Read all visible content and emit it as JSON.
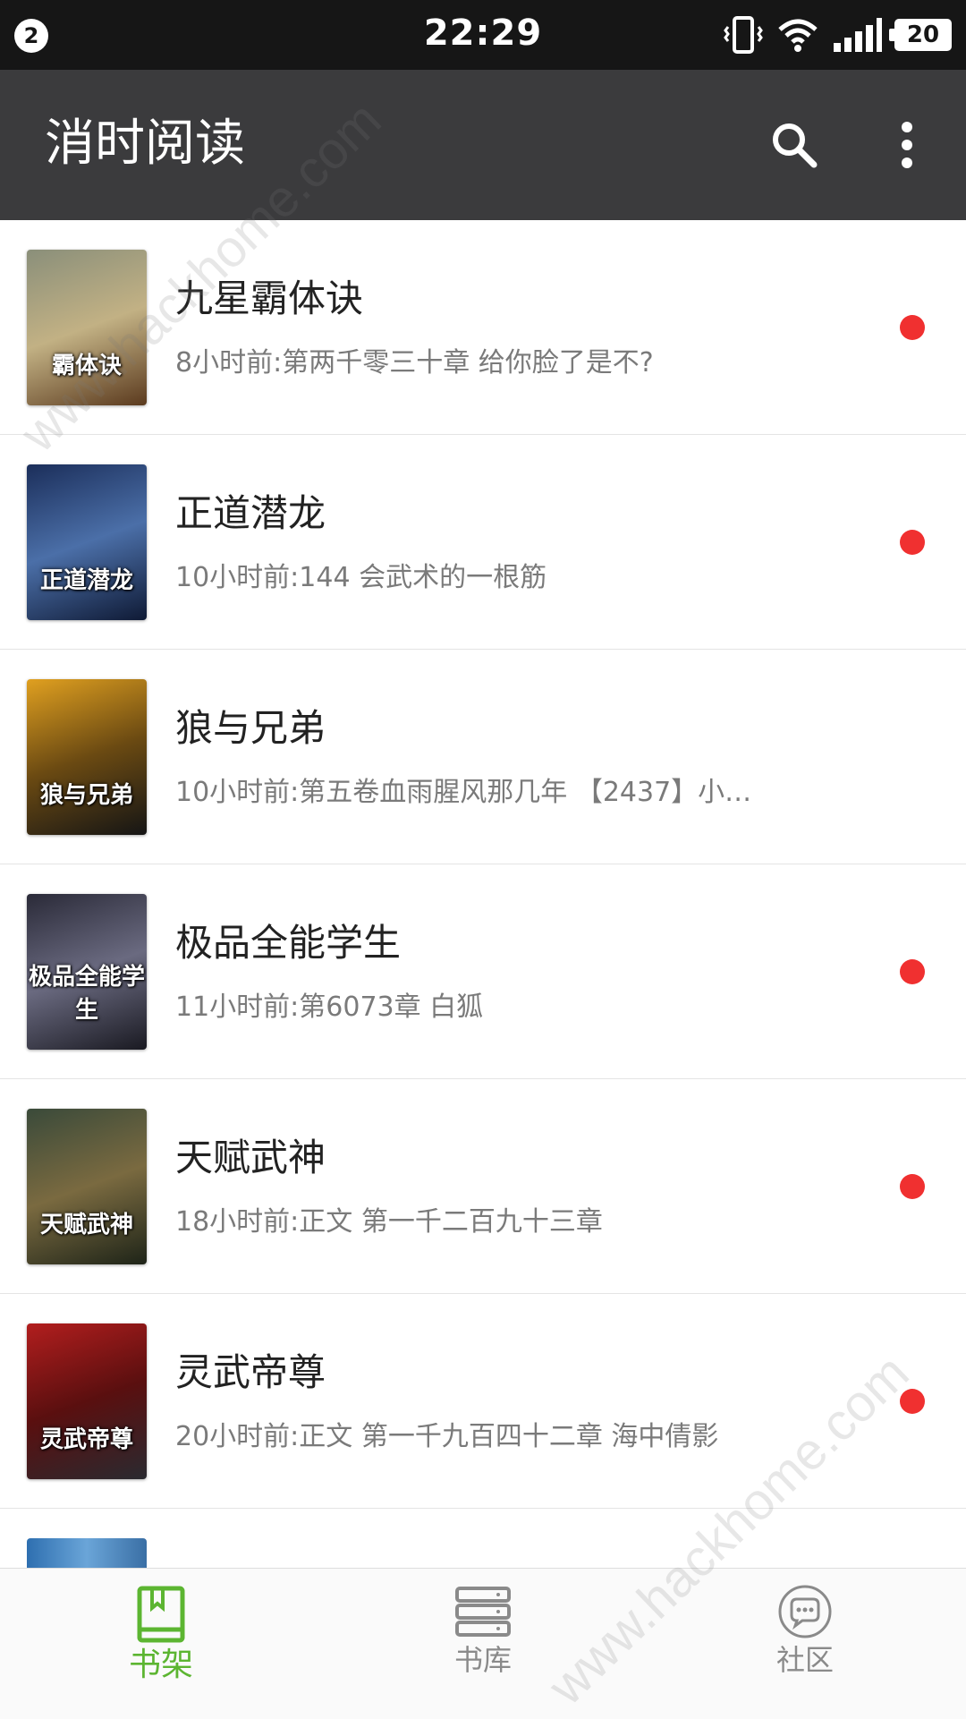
{
  "status_bar": {
    "notification_count": "2",
    "time": "22:29",
    "battery": "20",
    "icons": [
      "vibrate-icon",
      "wifi-icon",
      "signal-icon",
      "battery-icon"
    ]
  },
  "app_bar": {
    "title": "消时阅读",
    "actions": [
      "search-icon",
      "more-vert-icon"
    ]
  },
  "books": [
    {
      "title": "九星霸体诀",
      "update": "8小时前:第两千零三十章 给你脸了是不?",
      "unread": true,
      "cover_text": "霸体诀",
      "cover_colors": [
        "#8a8f7a",
        "#c2b184",
        "#5b3a1e"
      ]
    },
    {
      "title": "正道潜龙",
      "update": "10小时前:144 会武术的一根筋",
      "unread": true,
      "cover_text": "正道潜龙",
      "cover_colors": [
        "#1b2e5a",
        "#4b6fa8",
        "#0f1a35"
      ]
    },
    {
      "title": "狼与兄弟",
      "update": "10小时前:第五卷血雨腥风那几年 【2437】小…",
      "unread": false,
      "cover_text": "狼与兄弟",
      "cover_colors": [
        "#e0a020",
        "#6b4a12",
        "#151515"
      ]
    },
    {
      "title": "极品全能学生",
      "update": "11小时前:第6073章 白狐",
      "unread": true,
      "cover_text": "极品全能学生",
      "cover_colors": [
        "#2a2a38",
        "#6a6a80",
        "#1a1a22"
      ]
    },
    {
      "title": "天赋武神",
      "update": "18小时前:正文 第一千二百九十三章",
      "unread": true,
      "cover_text": "天赋武神",
      "cover_colors": [
        "#3a4a3a",
        "#7a6a40",
        "#1e2418"
      ]
    },
    {
      "title": "灵武帝尊",
      "update": "20小时前:正文 第一千九百四十二章 海中倩影",
      "unread": true,
      "cover_text": "灵武帝尊",
      "cover_colors": [
        "#b21e1e",
        "#5a0f0f",
        "#2a2a30"
      ]
    }
  ],
  "bottom_nav": [
    {
      "label": "书架",
      "icon": "bookshelf-icon",
      "active": true
    },
    {
      "label": "书库",
      "icon": "library-icon",
      "active": false
    },
    {
      "label": "社区",
      "icon": "community-icon",
      "active": false
    }
  ],
  "colors": {
    "status_bar": "#161616",
    "app_bar": "#3b3b3d",
    "accent": "#5cb531",
    "unread_dot": "#f03030"
  },
  "watermark": "www.hackhome.com"
}
